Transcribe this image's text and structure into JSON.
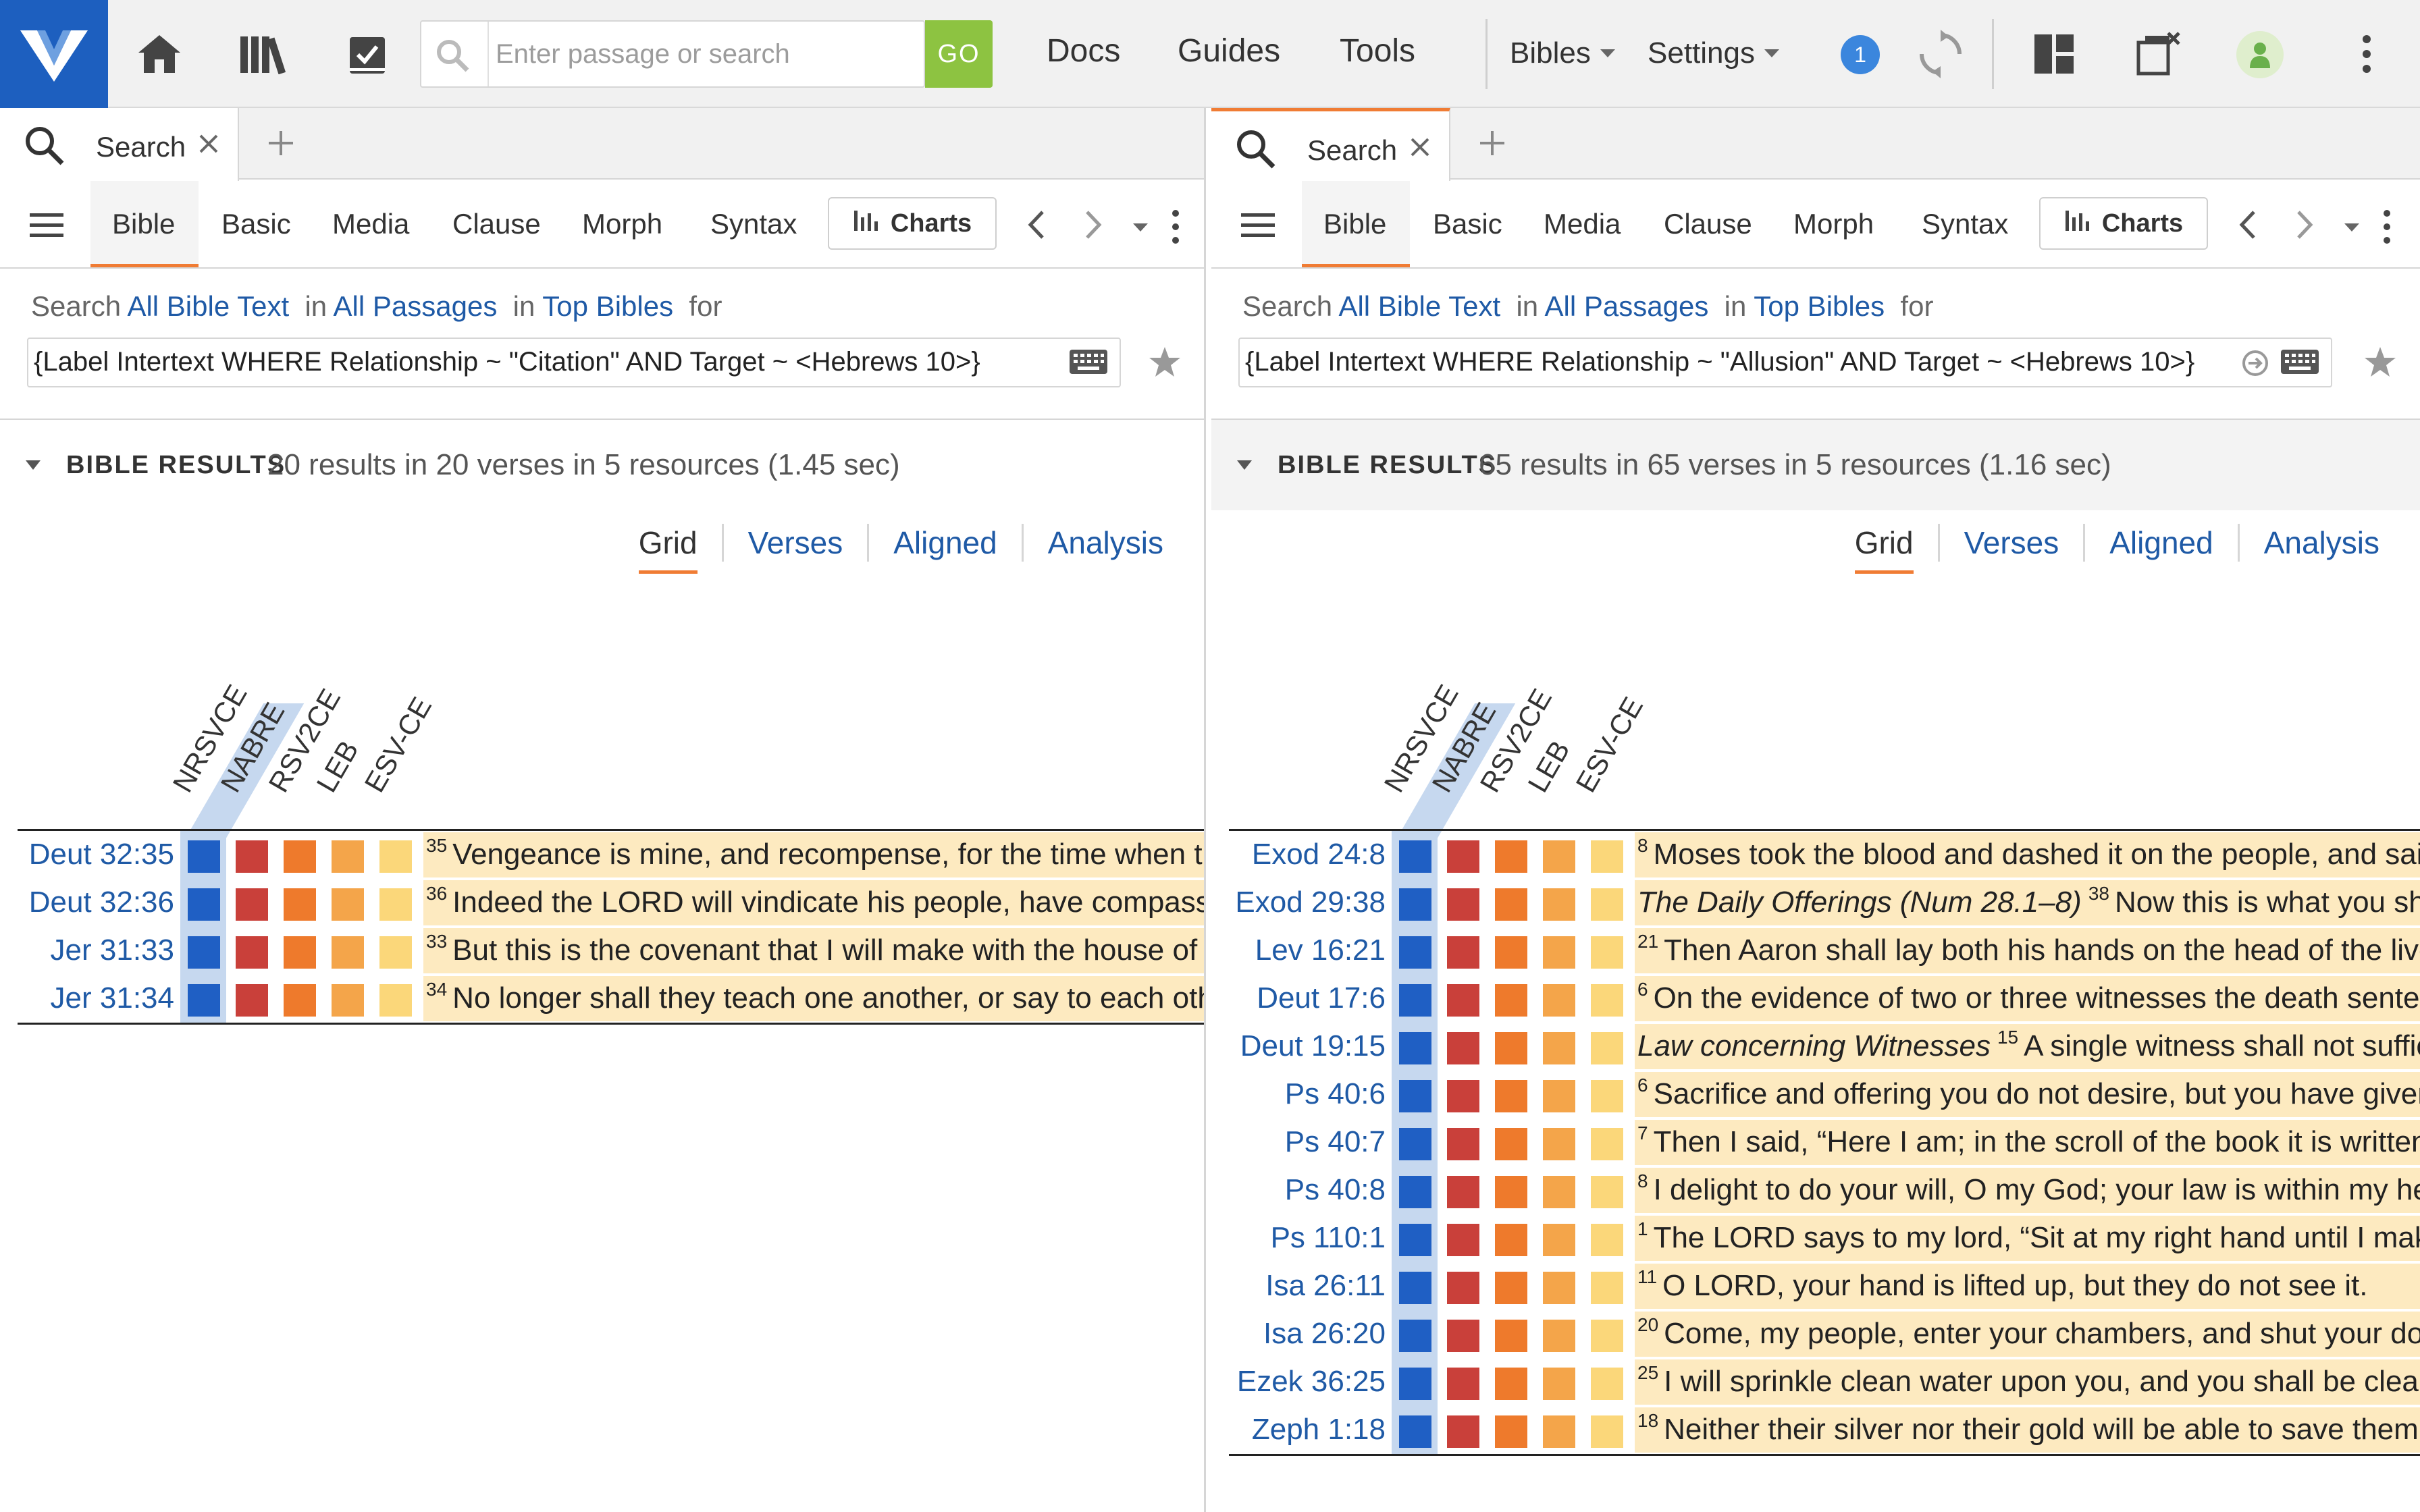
{
  "toolbar": {
    "search_placeholder": "Enter passage or search",
    "go_label": "GO",
    "nav": [
      "Docs",
      "Guides",
      "Tools"
    ],
    "bibles_label": "Bibles",
    "settings_label": "Settings",
    "notification_count": "1"
  },
  "panels": [
    {
      "tab_label": "Search",
      "subtabs": [
        "Bible",
        "Basic",
        "Media",
        "Clause",
        "Morph",
        "Syntax"
      ],
      "charts_label": "Charts",
      "query": {
        "search_word": "Search",
        "scope_text": "All Bible Text",
        "in1": "in",
        "passages": "All Passages",
        "in2": "in",
        "bibles": "Top Bibles",
        "for_word": "for",
        "text": "{Label Intertext WHERE Relationship ~ \"Citation\" AND Target ~ <Hebrews 10>}"
      },
      "results_title": "BIBLE RESULTS",
      "results_summary": "20 results in 20 verses in 5 resources (1.45 sec)",
      "view_tabs": [
        "Grid",
        "Verses",
        "Aligned",
        "Analysis"
      ],
      "versions": [
        "NRSVCE",
        "NABRE",
        "RSV2CE",
        "LEB",
        "ESV-CE"
      ],
      "rows": [
        {
          "ref": "Deut 32:35",
          "num": "35",
          "heading": "",
          "text": "Vengeance is mine, and recompense, for the time when their foot shall slip"
        },
        {
          "ref": "Deut 32:36",
          "num": "36",
          "heading": "",
          "text": "Indeed the LORD will vindicate his people, have compassion on his servants"
        },
        {
          "ref": "Jer 31:33",
          "num": "33",
          "heading": "",
          "text": "But this is the covenant that I will make with the house of Israel"
        },
        {
          "ref": "Jer 31:34",
          "num": "34",
          "heading": "",
          "text": "No longer shall they teach one another, or say to each other"
        }
      ]
    },
    {
      "tab_label": "Search",
      "subtabs": [
        "Bible",
        "Basic",
        "Media",
        "Clause",
        "Morph",
        "Syntax"
      ],
      "charts_label": "Charts",
      "query": {
        "search_word": "Search",
        "scope_text": "All Bible Text",
        "in1": "in",
        "passages": "All Passages",
        "in2": "in",
        "bibles": "Top Bibles",
        "for_word": "for",
        "text": "{Label Intertext WHERE Relationship ~ \"Allusion\" AND Target ~ <Hebrews 10>}"
      },
      "results_title": "BIBLE RESULTS",
      "results_summary": "65 results in 65 verses in 5 resources (1.16 sec)",
      "view_tabs": [
        "Grid",
        "Verses",
        "Aligned",
        "Analysis"
      ],
      "versions": [
        "NRSVCE",
        "NABRE",
        "RSV2CE",
        "LEB",
        "ESV-CE"
      ],
      "rows": [
        {
          "ref": "Exod 24:8",
          "num": "8",
          "heading": "",
          "text": "Moses took the blood and dashed it on the people, and said"
        },
        {
          "ref": "Exod 29:38",
          "num": "38",
          "heading": "The Daily Offerings (Num 28.1–8)",
          "text": "Now this is what you shall offer"
        },
        {
          "ref": "Lev 16:21",
          "num": "21",
          "heading": "",
          "text": "Then Aaron shall lay both his hands on the head of the live goat"
        },
        {
          "ref": "Deut 17:6",
          "num": "6",
          "heading": "",
          "text": "On the evidence of two or three witnesses the death sentence"
        },
        {
          "ref": "Deut 19:15",
          "num": "15",
          "heading": "Law concerning Witnesses",
          "text": "A single witness shall not suffice"
        },
        {
          "ref": "Ps 40:6",
          "num": "6",
          "heading": "",
          "text": "Sacrifice and offering you do not desire, but you have given me"
        },
        {
          "ref": "Ps 40:7",
          "num": "7",
          "heading": "",
          "text": "Then I said, “Here I am; in the scroll of the book it is written"
        },
        {
          "ref": "Ps 40:8",
          "num": "8",
          "heading": "",
          "text": "I delight to do your will, O my God; your law is within my heart"
        },
        {
          "ref": "Ps 110:1",
          "num": "1",
          "heading": "",
          "text": "The LORD says to my lord, “Sit at my right hand until I make"
        },
        {
          "ref": "Isa 26:11",
          "num": "11",
          "heading": "",
          "text": "O LORD, your hand is lifted up, but they do not see it."
        },
        {
          "ref": "Isa 26:20",
          "num": "20",
          "heading": "",
          "text": "Come, my people, enter your chambers, and shut your doors"
        },
        {
          "ref": "Ezek 36:25",
          "num": "25",
          "heading": "",
          "text": "I will sprinkle clean water upon you, and you shall be clean"
        },
        {
          "ref": "Zeph 1:18",
          "num": "18",
          "heading": "",
          "text": "Neither their silver nor their gold will be able to save them"
        }
      ]
    }
  ],
  "colors": {
    "brand": "#1d5fbf",
    "accent": "#f07c34",
    "go": "#8dc341",
    "link": "#1f5aa6",
    "version_cells": [
      "#1f5fc4",
      "#c9403a",
      "#ee7a2c",
      "#f4a54a",
      "#fbd77a"
    ],
    "verse_bg": "#fdeac0"
  },
  "icons": [
    "logo-icon",
    "home-icon",
    "library-icon",
    "checklist-icon",
    "search-icon",
    "sync-icon",
    "layout-icon",
    "close-panels-icon",
    "user-icon",
    "more-vert-icon",
    "menu-icon",
    "bar-chart-icon",
    "chevron-left-icon",
    "chevron-right-icon",
    "keyboard-icon",
    "star-icon",
    "close-icon",
    "plus-icon"
  ]
}
